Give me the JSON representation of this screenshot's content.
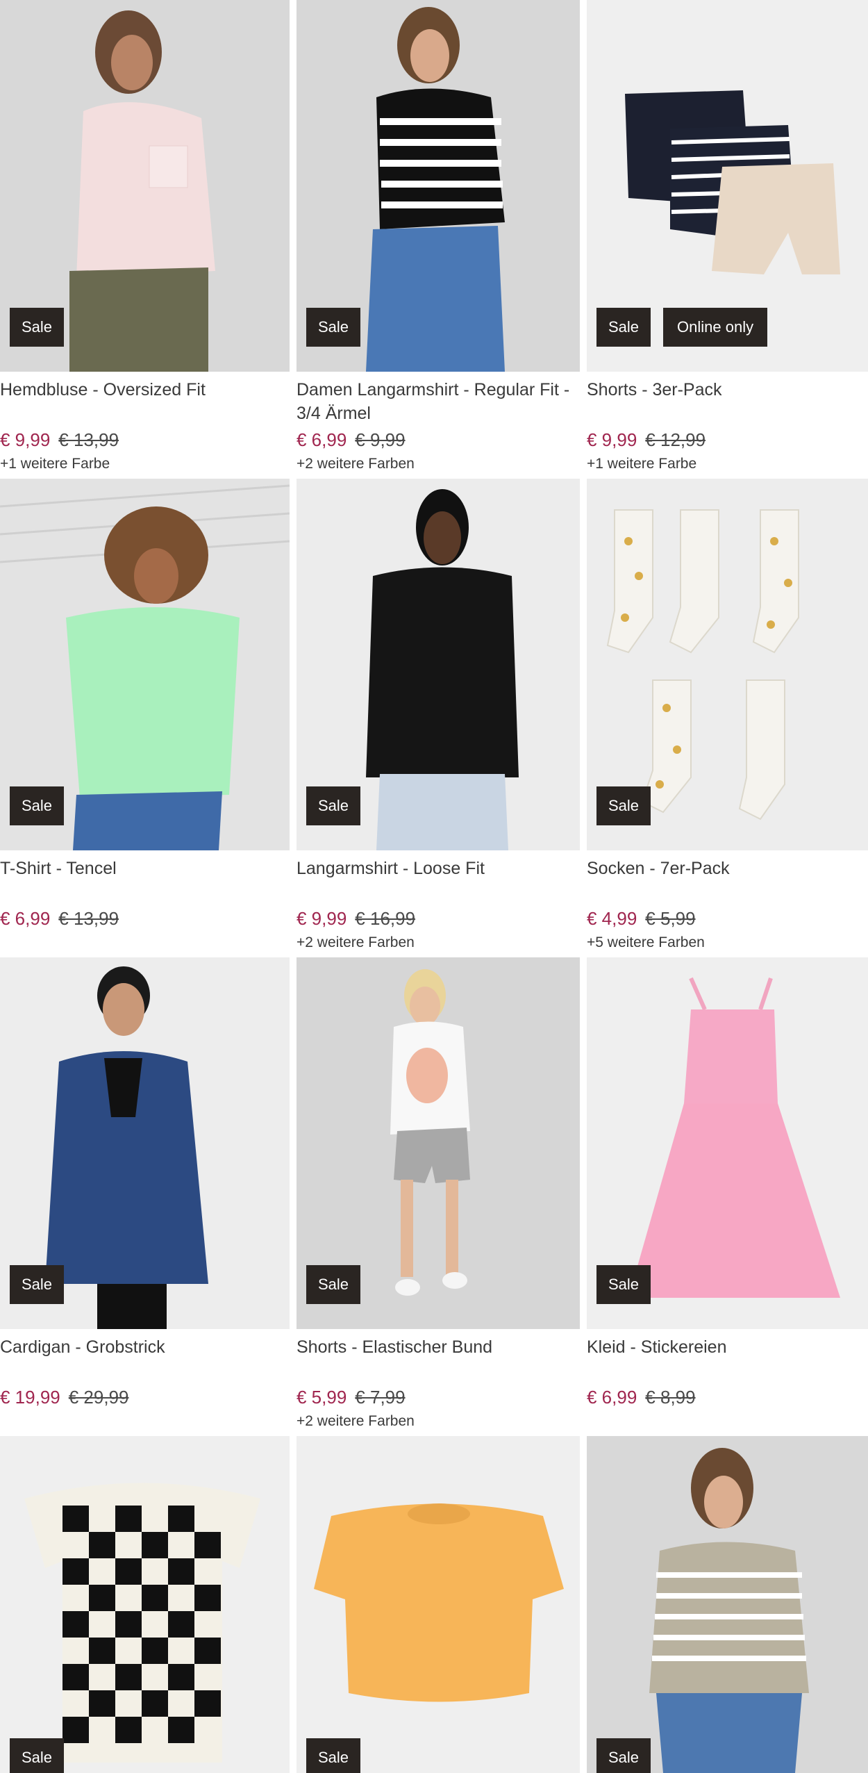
{
  "products": [
    {
      "title": "Hemdbluse - Oversized Fit",
      "price": "€ 9,99",
      "old_price": "€ 13,99",
      "colors": "+1 weitere Farbe",
      "badges": [
        "Sale"
      ],
      "image": "blouse-image",
      "bg": "#d9d9d9"
    },
    {
      "title": "Damen Langarmshirt - Regular Fit - 3/4 Ärmel",
      "price": "€ 6,99",
      "old_price": "€ 9,99",
      "colors": "+2 weitere Farben",
      "badges": [
        "Sale"
      ],
      "image": "striped-shirt-image",
      "bg": "#d7d7d7"
    },
    {
      "title": "Shorts - 3er-Pack",
      "price": "€ 9,99",
      "old_price": "€ 12,99",
      "colors": "+1 weitere Farbe",
      "badges": [
        "Sale",
        "Online only"
      ],
      "image": "shorts-pack-image",
      "bg": "#efefef"
    },
    {
      "title": "T-Shirt - Tencel",
      "price": "€ 6,99",
      "old_price": "€ 13,99",
      "colors": "",
      "badges": [
        "Sale"
      ],
      "image": "tshirt-image",
      "bg": "#e3e3e3"
    },
    {
      "title": "Langarmshirt - Loose Fit",
      "price": "€ 9,99",
      "old_price": "€ 16,99",
      "colors": "+2 weitere Farben",
      "badges": [
        "Sale"
      ],
      "image": "longsleeve-image",
      "bg": "#ececec"
    },
    {
      "title": "Socken - 7er-Pack",
      "price": "€ 4,99",
      "old_price": "€ 5,99",
      "colors": "+5 weitere Farben",
      "badges": [
        "Sale"
      ],
      "image": "socks-image",
      "bg": "#ededed"
    },
    {
      "title": "Cardigan - Grobstrick",
      "price": "€ 19,99",
      "old_price": "€ 29,99",
      "colors": "",
      "badges": [
        "Sale"
      ],
      "image": "cardigan-image",
      "bg": "#ededed"
    },
    {
      "title": "Shorts - Elastischer Bund",
      "price": "€ 5,99",
      "old_price": "€ 7,99",
      "colors": "+2 weitere Farben",
      "badges": [
        "Sale"
      ],
      "image": "shorts-image",
      "bg": "#d6d6d6"
    },
    {
      "title": "Kleid - Stickereien",
      "price": "€ 6,99",
      "old_price": "€ 8,99",
      "colors": "",
      "badges": [
        "Sale"
      ],
      "image": "dress-image",
      "bg": "#efefef"
    },
    {
      "title": "",
      "price": "",
      "old_price": "",
      "colors": "",
      "badges": [
        "Sale"
      ],
      "image": "checkered-tshirt-image",
      "bg": "#efefef"
    },
    {
      "title": "",
      "price": "",
      "old_price": "",
      "colors": "",
      "badges": [
        "Sale"
      ],
      "image": "yellow-tshirt-image",
      "bg": "#efefef"
    },
    {
      "title": "",
      "price": "",
      "old_price": "",
      "colors": "",
      "badges": [
        "Sale"
      ],
      "image": "striped-sweater-image",
      "bg": "#d8d8d8"
    }
  ],
  "colors": {
    "sale_price": "#a0264f",
    "badge_bg": "#2a2522",
    "badge_text": "#ffffff"
  }
}
